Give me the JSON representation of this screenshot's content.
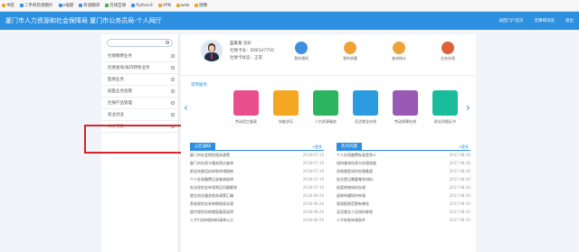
{
  "bookmarks": [
    {
      "label": "书签",
      "color": "#f0a23a"
    },
    {
      "label": "二手机检测图片",
      "color": "#3d8fe0"
    },
    {
      "label": "e福建",
      "color": "#3d8fe0"
    },
    {
      "label": "有道翻译",
      "color": "#3d8fe0"
    },
    {
      "label": "在线互保",
      "color": "#4caf50"
    },
    {
      "label": "Python3",
      "color": "#3d8fe0"
    },
    {
      "label": "VPN",
      "color": "#f0a23a"
    },
    {
      "label": "web",
      "color": "#f0a23a"
    },
    {
      "label": "图像",
      "color": "#f0a23a"
    }
  ],
  "header": {
    "title": "厦门市人力资源和社会保障局 厦门市公务员局-个人网厅",
    "links": [
      "返回门户首页",
      "无障碍浏览",
      "退出"
    ]
  },
  "sidebar": {
    "search_placeholder": "",
    "items": [
      {
        "label": "社保缴费业务"
      },
      {
        "label": "社保查询/省内转移业务"
      },
      {
        "label": "医保业务"
      },
      {
        "label": "就医业务指南"
      },
      {
        "label": "社保产品管理"
      },
      {
        "label": "就业创业"
      },
      {
        "label": "人才引进"
      }
    ]
  },
  "profile": {
    "name": "蓝某某",
    "name_suffix": "您好",
    "id_label": "社保卡号：",
    "id_value": "D06147750",
    "status_label": "社保卡状态：",
    "status_value": "正常"
  },
  "quick_links": [
    {
      "label": "我的通知",
      "color": "#3d8fe0"
    },
    {
      "label": "我的收藏",
      "color": "#f0a23a"
    },
    {
      "label": "查询统计",
      "color": "#f0a23a"
    },
    {
      "label": "业务办理",
      "color": "#e0603a"
    }
  ],
  "services": {
    "title": "常用服务",
    "items": [
      {
        "label": "劳动用工备案",
        "color": "#e84f8c"
      },
      {
        "label": "技能学历",
        "color": "#f5a623"
      },
      {
        "label": "人力资源服务",
        "color": "#2db45f"
      },
      {
        "label": "灵活就业在线",
        "color": "#2c9ce0"
      },
      {
        "label": "劳动保障在线",
        "color": "#9b59b6"
      },
      {
        "label": "职业资格证书",
        "color": "#1abc9c"
      }
    ]
  },
  "news_panels": [
    {
      "tab": "公告通知",
      "more": "+更多",
      "rows": [
        {
          "title": "厦门市社会保险相关政策",
          "date": "2018-07-19"
        },
        {
          "title": "厦门市社保卡服务网点查询",
          "date": "2018-07-19"
        },
        {
          "title": "职业技能培训补贴申领指南",
          "date": "2018-07-19"
        },
        {
          "title": "个人社保缴费记录查询说明",
          "date": "2018-07-19"
        },
        {
          "title": "失业保险金申领常见问题解答",
          "date": "2018-07-19"
        },
        {
          "title": "就业创业服务相关政策汇编",
          "date": "2018-06-26"
        },
        {
          "title": "养老保险关系转移接续办理",
          "date": "2018-06-26"
        },
        {
          "title": "医疗保险异地就医备案说明",
          "date": "2018-06-26"
        },
        {
          "title": "人才引进申报材料清单公示",
          "date": "2018-06-26"
        }
      ]
    },
    {
      "tab": "热点问题",
      "more": "+更多",
      "rows": [
        {
          "title": "个人社保缴费标准是多少",
          "date": "2017-08-30"
        },
        {
          "title": "如何查询社保卡办理进度",
          "date": "2017-08-30"
        },
        {
          "title": "异地就医如何办理备案",
          "date": "2017-08-30"
        },
        {
          "title": "失业登记需要哪些材料",
          "date": "2017-08-30"
        },
        {
          "title": "档案转移如何办理",
          "date": "2017-08-30"
        },
        {
          "title": "退休待遇如何申请",
          "date": "2017-08-30"
        },
        {
          "title": "医保报销范围有哪些",
          "date": "2017-08-30"
        },
        {
          "title": "灵活就业人员如何参保",
          "date": "2017-08-30"
        },
        {
          "title": "人才补贴申请条件",
          "date": "2017-08-30"
        }
      ]
    }
  ]
}
